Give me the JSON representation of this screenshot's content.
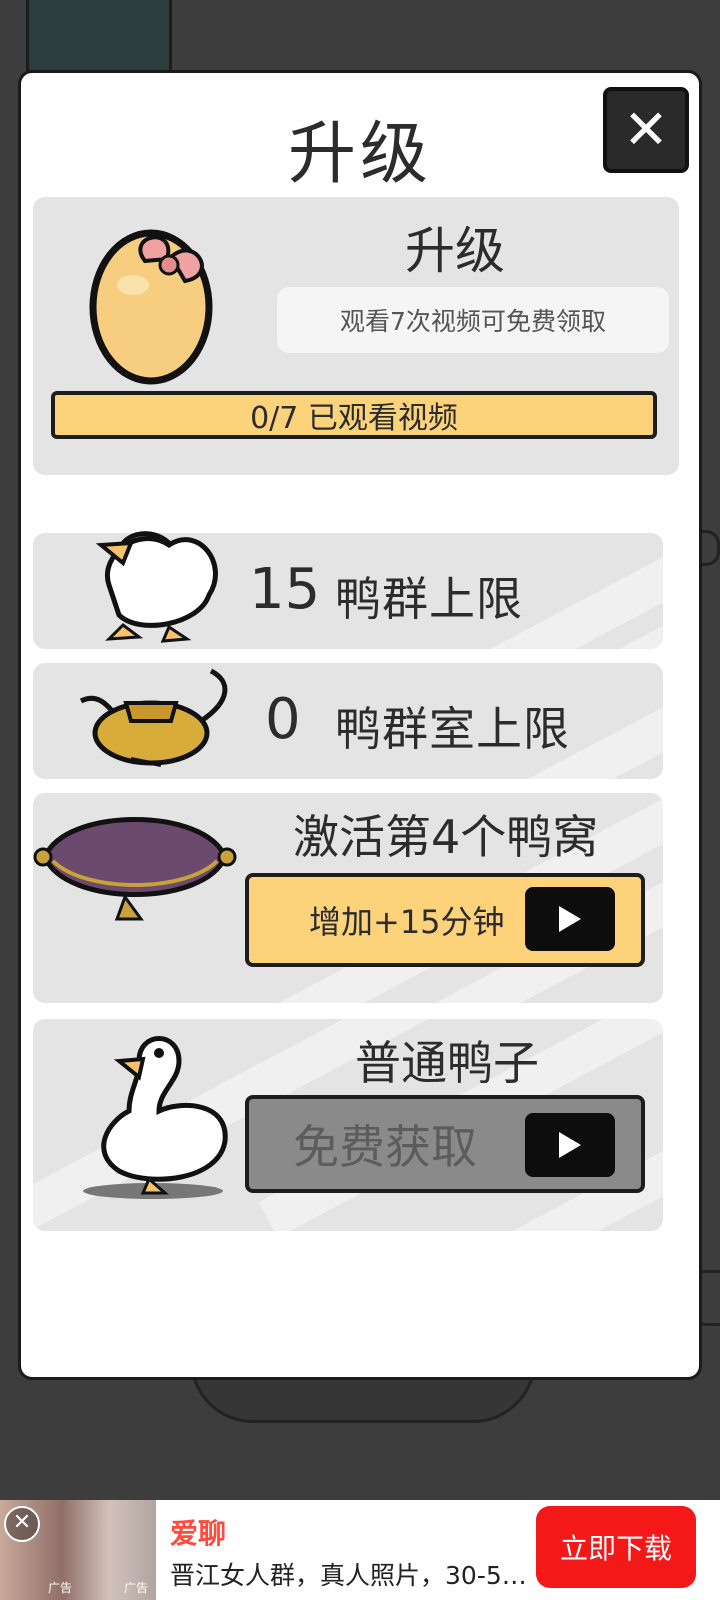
{
  "dialog": {
    "title": "升级",
    "close_label": "✕"
  },
  "upgrade_card": {
    "title": "升级",
    "hint": "观看7次视频可免费领取",
    "progress_text": "0/7 已观看视频",
    "progress_fraction": 0
  },
  "stats": [
    {
      "value": "15",
      "label": "鸭群上限",
      "icon": "duck-running-icon"
    },
    {
      "value": "0",
      "label": "鸭群室上限",
      "icon": "golden-teapot-icon"
    }
  ],
  "nest_card": {
    "title": "激活第4个鸭窝",
    "button_label": "增加+15分钟",
    "icon": "purple-cushion-icon"
  },
  "duck_card": {
    "title": "普通鸭子",
    "button_label": "免费获取",
    "icon": "white-duck-icon"
  },
  "ad": {
    "brand": "爱聊",
    "description": "晋江女人群，真人照片，30-5…",
    "download_label": "立即下载",
    "tag_1": "广告",
    "tag_2": "广告",
    "close_label": "✕"
  },
  "colors": {
    "accent_yellow": "#fcd27a",
    "ad_red": "#f41818",
    "card_grey": "#e4e4e4"
  }
}
